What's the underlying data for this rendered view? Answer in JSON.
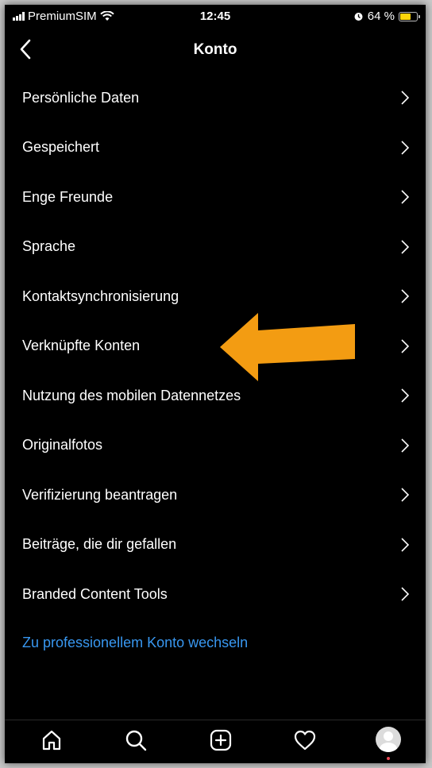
{
  "status_bar": {
    "carrier": "PremiumSIM",
    "time": "12:45",
    "battery": "64 %",
    "battery_level": 0.64
  },
  "header": {
    "title": "Konto",
    "back_icon": "chevron-left-icon"
  },
  "menu": {
    "items": [
      {
        "label": "Persönliche Daten"
      },
      {
        "label": "Gespeichert"
      },
      {
        "label": "Enge Freunde"
      },
      {
        "label": "Sprache"
      },
      {
        "label": "Kontaktsynchronisierung"
      },
      {
        "label": "Verknüpfte Konten"
      },
      {
        "label": "Nutzung des mobilen Datennetzes"
      },
      {
        "label": "Originalfotos"
      },
      {
        "label": "Verifizierung beantragen"
      },
      {
        "label": "Beiträge, die dir gefallen"
      },
      {
        "label": "Branded Content Tools"
      }
    ],
    "switch_account_link": "Zu professionellem Konto wechseln"
  },
  "bottom_nav": {
    "items": [
      "home-icon",
      "search-icon",
      "add-post-icon",
      "heart-icon",
      "profile-avatar"
    ]
  },
  "colors": {
    "background": "#000000",
    "text": "#ffffff",
    "link": "#3897f0",
    "annotation_arrow": "#f39c12",
    "battery": "#ffd60a"
  }
}
